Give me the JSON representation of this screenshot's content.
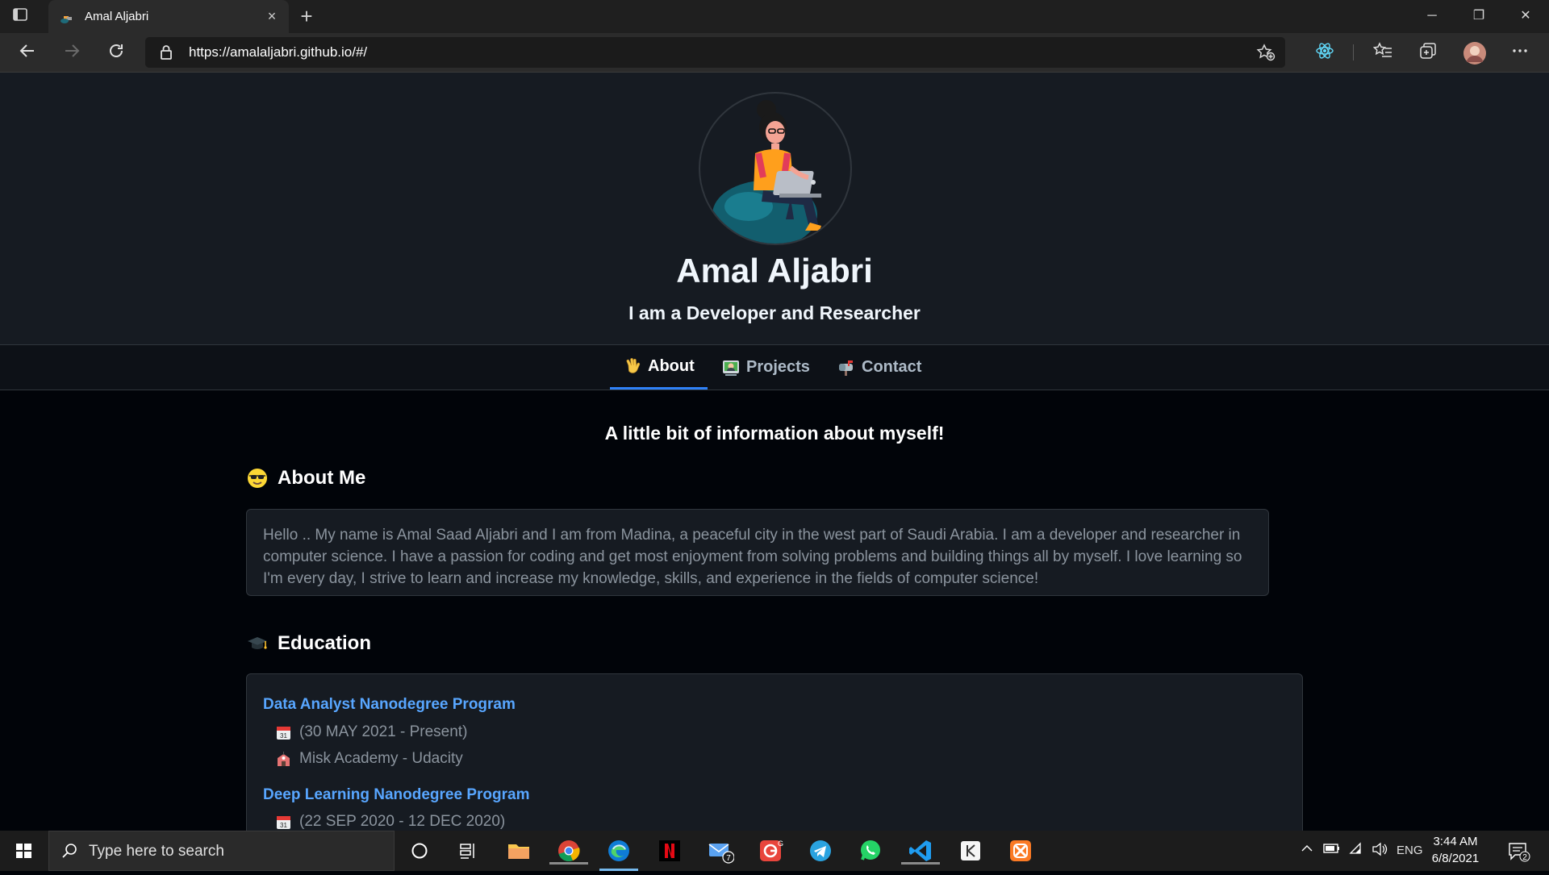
{
  "browser": {
    "tab_title": "Amal Aljabri",
    "tab_close": "×",
    "new_tab": "+",
    "url": "https://amalaljabri.github.io/#/",
    "window_controls": [
      "─",
      "❐",
      "✕"
    ]
  },
  "page": {
    "name": "Amal Aljabri",
    "tagline": "I am a Developer and Researcher",
    "nav_tabs": [
      {
        "label": "About",
        "icon": "waving-hand-icon",
        "active": true
      },
      {
        "label": "Projects",
        "icon": "technologist-icon",
        "active": false
      },
      {
        "label": "Contact",
        "icon": "mailbox-icon",
        "active": false
      }
    ],
    "intro": "A little bit of information about myself!",
    "about": {
      "heading": "About Me",
      "icon": "sunglasses-face-icon",
      "text": "Hello .. My name is Amal Saad Aljabri and I am from Madina, a peaceful city in the west part of Saudi Arabia. I am a developer and researcher in computer science. I have a passion for coding and get most enjoyment from solving problems and building things all by myself. I love learning so I'm every day, I strive to learn and increase my knowledge, skills, and experience in the fields of computer science!"
    },
    "education": {
      "heading": "Education",
      "icon": "graduation-cap-icon",
      "items": [
        {
          "title": "Data Analyst Nanodegree Program",
          "dates": "(30 MAY 2021 - Present)",
          "org": "Misk Academy - Udacity"
        },
        {
          "title": "Deep Learning Nanodegree Program",
          "dates": "(22 SEP 2020 - 12 DEC 2020)",
          "org": ""
        }
      ]
    }
  },
  "taskbar": {
    "search_placeholder": "Type here to search",
    "mail_badge": "7",
    "language": "ENG",
    "time": "3:44 AM",
    "date": "6/8/2021",
    "notifications": "2"
  },
  "colors": {
    "header_bg": "#161b22",
    "page_bg": "#010409",
    "link": "#58a6ff",
    "accent_underline": "#2f81f7"
  }
}
